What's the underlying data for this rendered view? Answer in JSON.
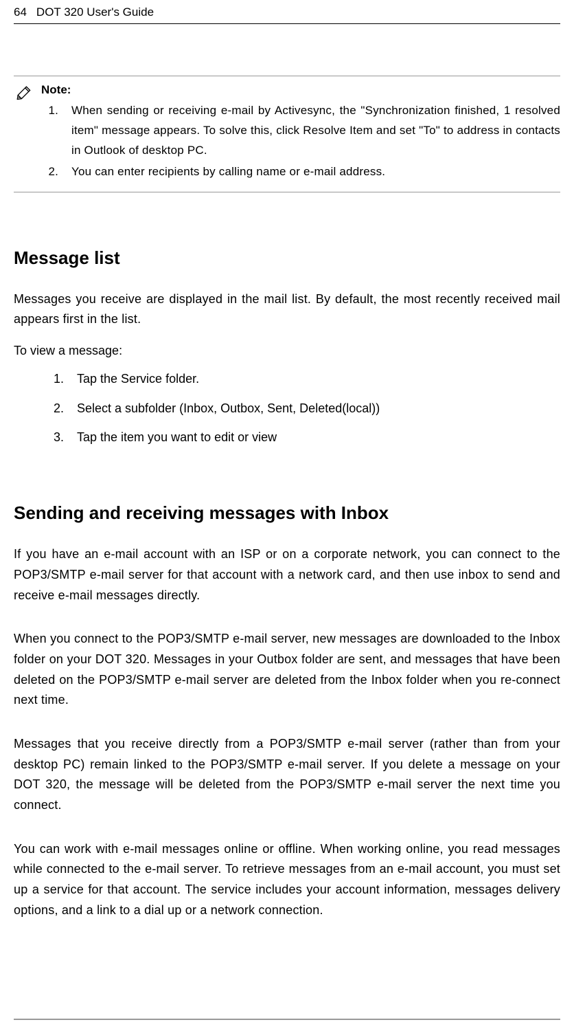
{
  "header": {
    "pageNumber": "64",
    "title": "DOT 320 User's Guide"
  },
  "note": {
    "label": "Note:",
    "items": [
      "When sending or receiving e-mail by Activesync, the \"Synchronization finished, 1 resolved item\" message appears. To solve this, click Resolve Item and set \"To\" to address in contacts in Outlook of desktop PC.",
      "You can enter recipients by calling name or e-mail address."
    ]
  },
  "section1": {
    "heading": "Message list",
    "intro": "Messages you receive are displayed in the mail list. By default, the most recently received mail appears first in the list.",
    "subintro": "To view a message:",
    "steps": [
      "Tap the Service folder.",
      "Select a subfolder (Inbox, Outbox, Sent, Deleted(local))",
      "Tap the item you want to edit or view"
    ]
  },
  "section2": {
    "heading": "Sending and receiving messages with Inbox",
    "paragraphs": [
      "If you have an e-mail account with an ISP or on a corporate network, you can connect to the POP3/SMTP e-mail server for that account with a network card, and then use inbox to send and receive e-mail messages directly.",
      "When you connect to the POP3/SMTP e-mail server, new messages are downloaded to the Inbox folder on your DOT 320. Messages in your Outbox folder are sent, and messages that have been deleted on the POP3/SMTP e-mail server are deleted from the Inbox folder when you re-connect next time.",
      "Messages that you receive directly from a POP3/SMTP e-mail server (rather than from your desktop PC) remain linked to the POP3/SMTP e-mail server. If you delete a message on your DOT 320, the message will be deleted from the POP3/SMTP e-mail server the next time you connect.",
      "You can work with e-mail messages online or offline. When working online, you read messages while connected to the e-mail server. To retrieve messages from an e-mail account, you must set up a service for that account. The service includes your account information, messages delivery options, and a link to a dial up or a network connection."
    ]
  }
}
